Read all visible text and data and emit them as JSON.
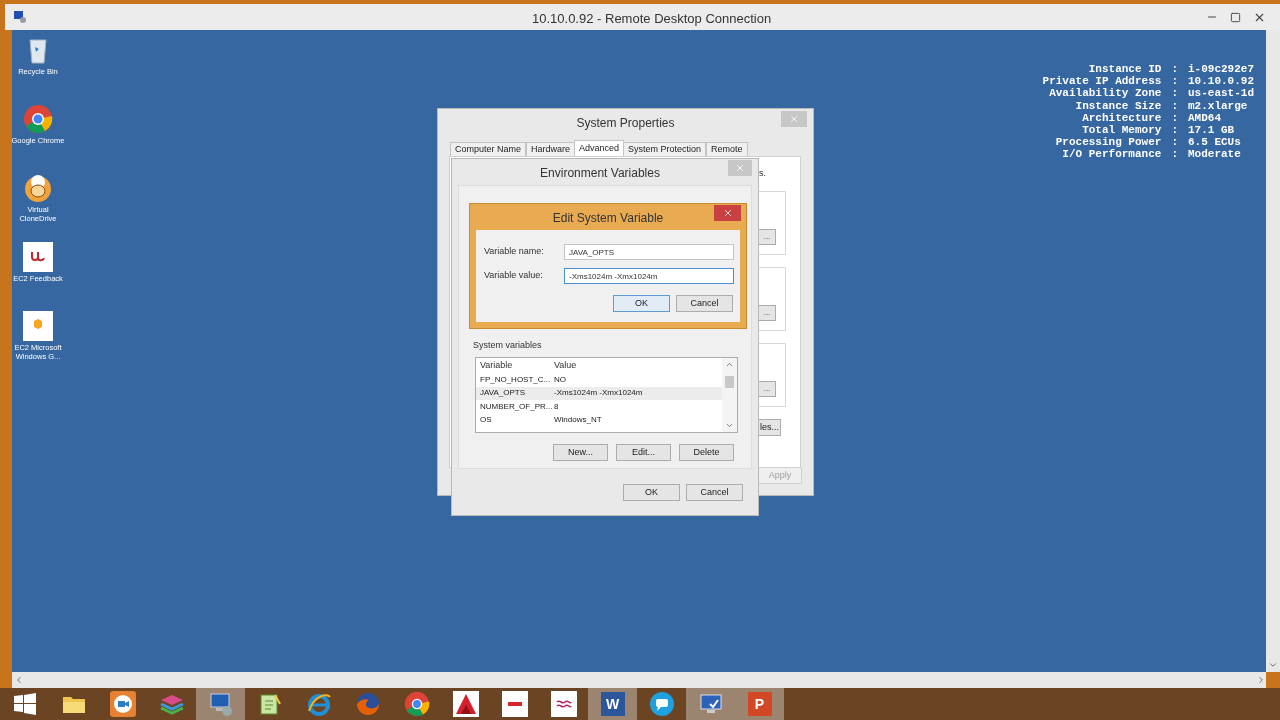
{
  "window": {
    "title": "10.10.0.92 - Remote Desktop Connection"
  },
  "desktop_icons": [
    {
      "label": "Recycle Bin",
      "kind": "recycle"
    },
    {
      "label": "Google Chrome",
      "kind": "chrome"
    },
    {
      "label": "Virtual CloneDrive",
      "kind": "sheep"
    },
    {
      "label": "EC2 Feedback",
      "kind": "feedback"
    },
    {
      "label": "EC2 Microsoft Windows G...",
      "kind": "package"
    }
  ],
  "instance_info": [
    {
      "label": "Instance ID",
      "separator": ":",
      "value": "i-09c292e7"
    },
    {
      "label": "Private IP Address",
      "separator": ":",
      "value": "10.10.0.92"
    },
    {
      "label": "Availability Zone",
      "separator": ":",
      "value": "us-east-1d"
    },
    {
      "label": "Instance Size",
      "separator": ":",
      "value": "m2.xlarge"
    },
    {
      "label": "Architecture",
      "separator": ":",
      "value": "AMD64"
    },
    {
      "label": "Total Memory",
      "separator": ":",
      "value": "17.1 GB"
    },
    {
      "label": "Processing Power",
      "separator": ":",
      "value": "6.5 ECUs"
    },
    {
      "label": "I/O Performance",
      "separator": ":",
      "value": "Moderate"
    }
  ],
  "system_properties": {
    "title": "System Properties",
    "tabs": [
      {
        "label": "Computer Name",
        "selected": false
      },
      {
        "label": "Hardware",
        "selected": false
      },
      {
        "label": "Advanced",
        "selected": true
      },
      {
        "label": "System Protection",
        "selected": false
      },
      {
        "label": "Remote",
        "selected": false
      }
    ],
    "partial_text": "s.",
    "partial_buttons": [
      "...",
      "...",
      "..."
    ],
    "environment_button": "les...",
    "apply_button": {
      "label": "Apply",
      "disabled": true
    }
  },
  "environment_variables": {
    "title": "Environment Variables",
    "system_variables": {
      "label": "System variables",
      "columns": [
        "Variable",
        "Value"
      ],
      "rows": [
        {
          "variable": "FP_NO_HOST_C...",
          "value": "NO",
          "selected": false
        },
        {
          "variable": "JAVA_OPTS",
          "value": "-Xms1024m -Xmx1024m",
          "selected": true
        },
        {
          "variable": "NUMBER_OF_PR...",
          "value": "8",
          "selected": false
        },
        {
          "variable": "OS",
          "value": "Windows_NT",
          "selected": false
        }
      ],
      "buttons": [
        "New...",
        "Edit...",
        "Delete"
      ]
    },
    "buttons": [
      "OK",
      "Cancel"
    ]
  },
  "edit_dialog": {
    "title": "Edit System Variable",
    "fields": [
      {
        "label": "Variable name:",
        "value": "JAVA_OPTS"
      },
      {
        "label": "Variable value:",
        "value": "-Xms1024m -Xmx1024m"
      }
    ],
    "buttons": [
      {
        "label": "OK",
        "default": true
      },
      {
        "label": "Cancel",
        "default": false
      }
    ]
  },
  "taskbar": [
    {
      "kind": "windows",
      "active": false
    },
    {
      "kind": "folder",
      "active": false
    },
    {
      "kind": "camera",
      "active": false
    },
    {
      "kind": "layers",
      "active": false
    },
    {
      "kind": "remote",
      "active": true
    },
    {
      "kind": "notepad",
      "active": false
    },
    {
      "kind": "ie",
      "active": false
    },
    {
      "kind": "firefox",
      "active": false
    },
    {
      "kind": "chrome",
      "active": false
    },
    {
      "kind": "triangle",
      "active": false
    },
    {
      "kind": "redtile",
      "active": false
    },
    {
      "kind": "wave",
      "active": false
    },
    {
      "kind": "word",
      "active": true,
      "glyph": "W"
    },
    {
      "kind": "chat",
      "active": false
    },
    {
      "kind": "monitor",
      "active": true
    },
    {
      "kind": "powerpoint",
      "active": true,
      "glyph": "P"
    }
  ]
}
